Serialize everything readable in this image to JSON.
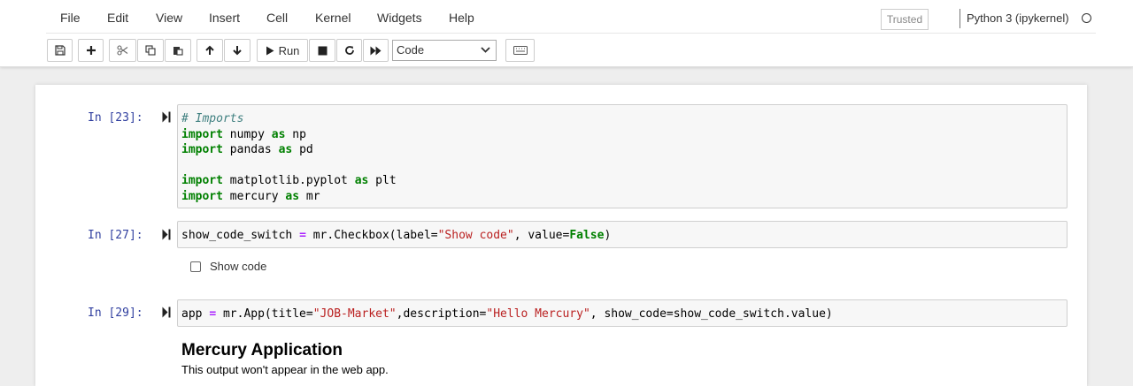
{
  "menu": [
    "File",
    "Edit",
    "View",
    "Insert",
    "Cell",
    "Kernel",
    "Widgets",
    "Help"
  ],
  "trusted_label": "Trusted",
  "kernel_name": "Python 3 (ipykernel)",
  "toolbar": {
    "run_label": "Run",
    "cell_type": "Code"
  },
  "cells": [
    {
      "prompt": "In [23]:",
      "lines": [
        [
          {
            "t": "# Imports",
            "c": "cm"
          }
        ],
        [
          {
            "t": "import",
            "c": "kw"
          },
          {
            "t": " numpy ",
            "c": ""
          },
          {
            "t": "as",
            "c": "kw"
          },
          {
            "t": " np",
            "c": ""
          }
        ],
        [
          {
            "t": "import",
            "c": "kw"
          },
          {
            "t": " pandas ",
            "c": ""
          },
          {
            "t": "as",
            "c": "kw"
          },
          {
            "t": " pd",
            "c": ""
          }
        ],
        [
          {
            "t": "",
            "c": ""
          }
        ],
        [
          {
            "t": "import",
            "c": "kw"
          },
          {
            "t": " matplotlib.pyplot ",
            "c": ""
          },
          {
            "t": "as",
            "c": "kw"
          },
          {
            "t": " plt",
            "c": ""
          }
        ],
        [
          {
            "t": "import",
            "c": "kw"
          },
          {
            "t": " mercury ",
            "c": ""
          },
          {
            "t": "as",
            "c": "kw"
          },
          {
            "t": " mr",
            "c": ""
          }
        ]
      ]
    },
    {
      "prompt": "In [27]:",
      "lines": [
        [
          {
            "t": "show_code_switch ",
            "c": ""
          },
          {
            "t": "=",
            "c": "op"
          },
          {
            "t": " mr.Checkbox(label=",
            "c": ""
          },
          {
            "t": "\"Show code\"",
            "c": "st"
          },
          {
            "t": ", value=",
            "c": ""
          },
          {
            "t": "False",
            "c": "bool"
          },
          {
            "t": ")",
            "c": ""
          }
        ]
      ]
    },
    {
      "prompt": "In [29]:",
      "lines": [
        [
          {
            "t": "app ",
            "c": ""
          },
          {
            "t": "=",
            "c": "op"
          },
          {
            "t": " mr.App(title=",
            "c": ""
          },
          {
            "t": "\"JOB-Market\"",
            "c": "st"
          },
          {
            "t": ",description=",
            "c": ""
          },
          {
            "t": "\"Hello Mercury\"",
            "c": "st"
          },
          {
            "t": ", show_code=show_code_switch.value)",
            "c": ""
          }
        ]
      ]
    }
  ],
  "checkbox_widget": {
    "label": "Show code",
    "checked": false
  },
  "output": {
    "title": "Mercury Application",
    "description": "This output won't appear in the web app."
  }
}
